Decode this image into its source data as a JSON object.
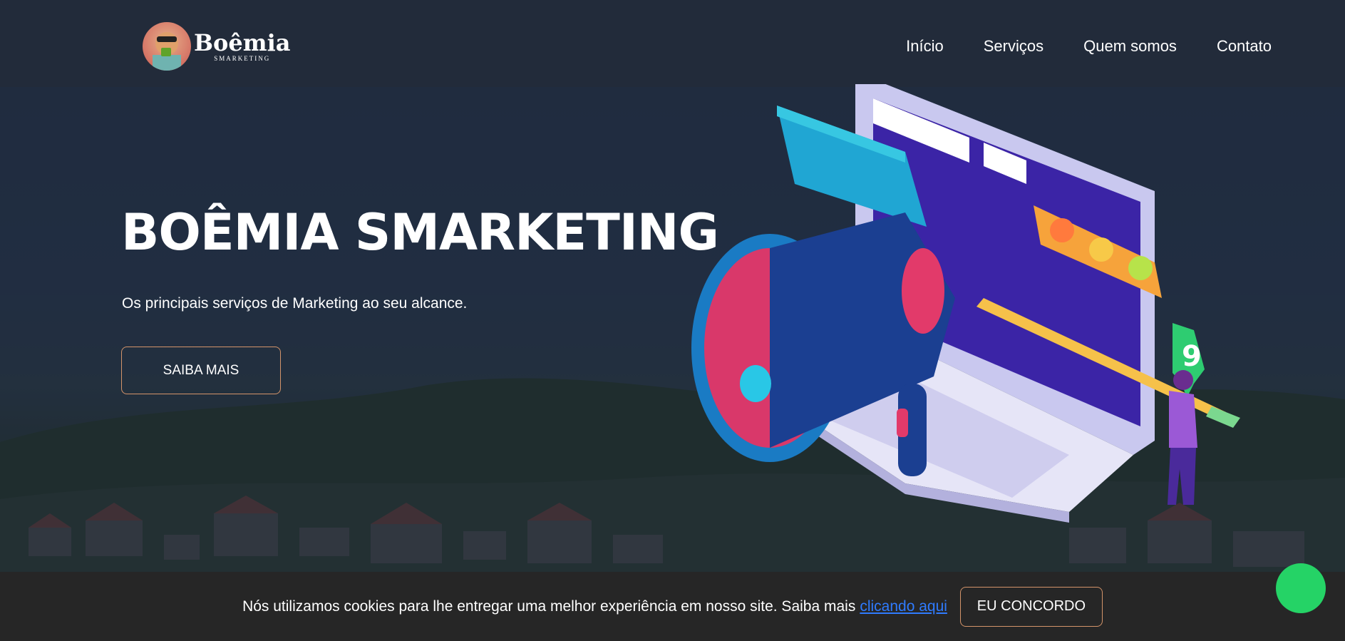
{
  "brand": {
    "name": "Boêmia",
    "subtitle": "SMARKETING"
  },
  "nav": {
    "items": [
      {
        "label": "Início"
      },
      {
        "label": "Serviços"
      },
      {
        "label": "Quem somos"
      },
      {
        "label": "Contato"
      }
    ]
  },
  "hero": {
    "title": "BOÊMIA SMARKETING",
    "subtitle": "Os principais serviços de Marketing ao seu alcance.",
    "cta_label": "SAIBA MAIS"
  },
  "cookie": {
    "text": "Nós utilizamos cookies para lhe entregar uma melhor experiência em nosso site. Saiba mais",
    "link_label": "clicando aqui",
    "accept_label": "EU CONCORDO"
  },
  "illustration": {
    "badge_number": "9"
  },
  "colors": {
    "navbar": "#222b3a",
    "accent_border": "#d4946a",
    "link": "#2f7bff",
    "cookie_bg": "#262626",
    "chat": "#25d366"
  },
  "icons": [
    "megaphone-icon",
    "laptop-icon",
    "emoji-rating-icon",
    "chat-icon"
  ]
}
